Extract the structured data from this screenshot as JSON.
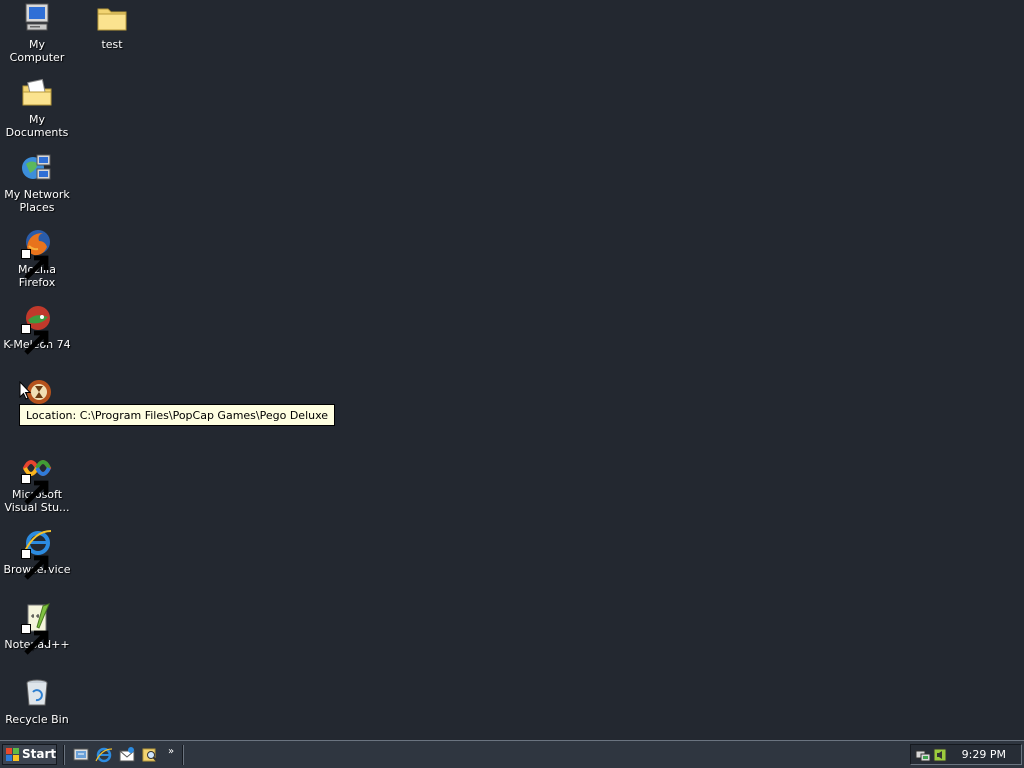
{
  "desktop": {
    "icons": [
      {
        "label": "My Computer",
        "icon": "computer-icon"
      },
      {
        "label": "test",
        "icon": "folder-icon"
      },
      {
        "label": "My Documents",
        "icon": "documents-folder-icon"
      },
      {
        "label": "My Network Places",
        "icon": "network-icon"
      },
      {
        "label": "Mozilla Firefox",
        "icon": "firefox-icon",
        "shortcut": true
      },
      {
        "label": "K-Meleon 74",
        "icon": "kmeleon-icon",
        "shortcut": true
      },
      {
        "label": "",
        "icon": "pego-deluxe-icon",
        "shortcut": true
      },
      {
        "label": "Microsoft Visual Stu...",
        "icon": "visual-studio-icon",
        "shortcut": true
      },
      {
        "label": "Browservice",
        "icon": "internet-explorer-icon",
        "shortcut": true
      },
      {
        "label": "Notepad++",
        "icon": "notepadpp-icon",
        "shortcut": true
      },
      {
        "label": "Recycle Bin",
        "icon": "recycle-bin-icon"
      }
    ]
  },
  "tooltip": {
    "text": "Location: C:\\Program Files\\PopCap Games\\Pego Deluxe"
  },
  "taskbar": {
    "start_label": "Start",
    "quick_launch": [
      {
        "icon": "show-desktop-icon"
      },
      {
        "icon": "internet-explorer-icon"
      },
      {
        "icon": "outlook-express-icon"
      },
      {
        "icon": "search-icon"
      }
    ],
    "more_label": "»",
    "tray_icons": [
      {
        "icon": "network-tray-icon"
      },
      {
        "icon": "volume-tray-icon"
      }
    ],
    "clock": "9:29 PM"
  },
  "colors": {
    "desktop_background": "#232830",
    "taskbar_background": "#2f3640",
    "tooltip_background": "#ffffe1"
  }
}
